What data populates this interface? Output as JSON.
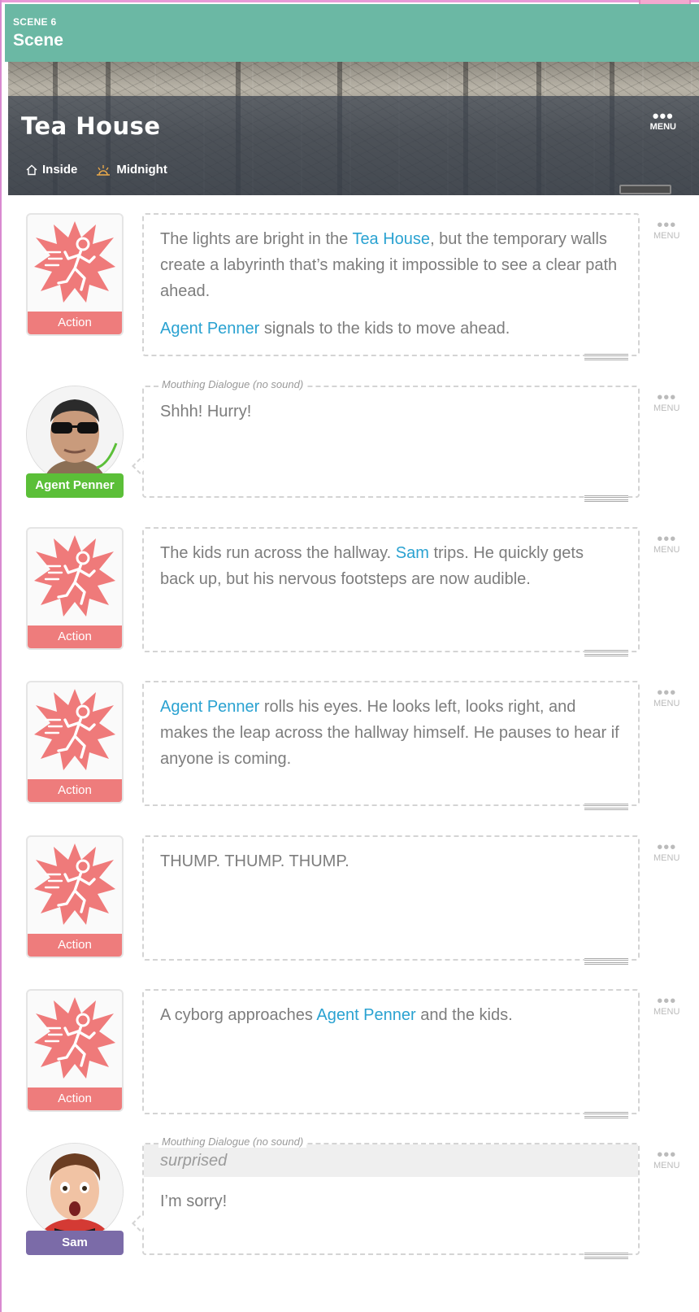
{
  "scene": {
    "number_label": "SCENE 6",
    "label": "Scene"
  },
  "location": {
    "title": "Tea House",
    "setting": "Inside",
    "time": "Midnight",
    "menu_label": "MENU"
  },
  "blocks": [
    {
      "type": "action",
      "avatar_label": "Action",
      "paragraphs": [
        [
          {
            "t": "The lights are bright in the "
          },
          {
            "t": "Tea House",
            "link": true
          },
          {
            "t": ", but the temporary walls create a labyrinth that’s making it impossible to see a clear path ahead."
          }
        ],
        [
          {
            "t": "Agent Penner",
            "link": true
          },
          {
            "t": " signals to the kids to move ahead."
          }
        ]
      ],
      "menu_label": "MENU"
    },
    {
      "type": "dialogue",
      "character": "Agent Penner",
      "character_color": "#5bbf38",
      "mouthing_label": "Mouthing Dialogue (no sound)",
      "text": "Shhh! Hurry!",
      "menu_label": "MENU"
    },
    {
      "type": "action",
      "avatar_label": "Action",
      "paragraphs": [
        [
          {
            "t": "The kids run across the hallway. "
          },
          {
            "t": "Sam",
            "link": true
          },
          {
            "t": " trips. He quickly gets back up, but his nervous footsteps are now audible."
          }
        ]
      ],
      "menu_label": "MENU"
    },
    {
      "type": "action",
      "avatar_label": "Action",
      "paragraphs": [
        [
          {
            "t": "Agent Penner",
            "link": true
          },
          {
            "t": " rolls his eyes. He looks left, looks right, and makes the leap across the hallway himself. He pauses to hear if anyone is coming."
          }
        ]
      ],
      "menu_label": "MENU"
    },
    {
      "type": "action",
      "avatar_label": "Action",
      "paragraphs": [
        [
          {
            "t": "THUMP. THUMP. THUMP."
          }
        ]
      ],
      "menu_label": "MENU"
    },
    {
      "type": "action",
      "avatar_label": "Action",
      "paragraphs": [
        [
          {
            "t": "A cyborg approaches "
          },
          {
            "t": "Agent Penner",
            "link": true
          },
          {
            "t": " and the kids."
          }
        ]
      ],
      "menu_label": "MENU"
    },
    {
      "type": "dialogue",
      "character": "Sam",
      "character_color": "#7b6ba8",
      "mouthing_label": "Mouthing Dialogue (no sound)",
      "emotion": "surprised",
      "text": "I’m sorry!",
      "menu_label": "MENU"
    }
  ],
  "colors": {
    "accent_link": "#2aa2d1",
    "action_red": "#ee7c7c",
    "scene_green": "#6bb8a4"
  }
}
